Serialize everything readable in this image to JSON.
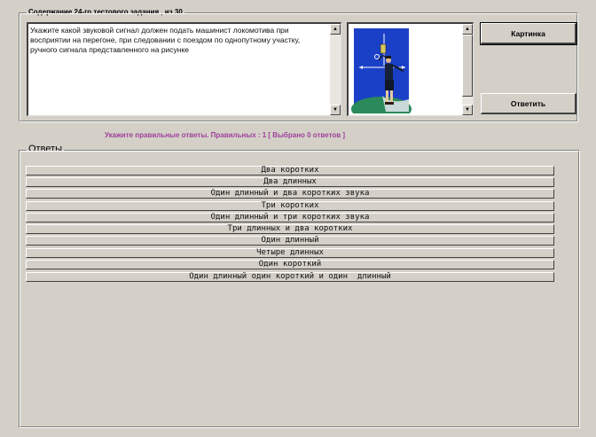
{
  "question": {
    "header": "Содержание 24-го тестового задания , из 30",
    "text": "Укажите какой звуковой сигнал должен подать машинист локомотива при восприятии на перегоне, при следовании с поездом по однопутному участку, ручного сигнала представленного на рисунке"
  },
  "buttons": {
    "picture": "Картинка",
    "answer": "Ответить"
  },
  "hint": "Укажите правильные ответы. Правильных : 1 [ Выбрано  0 ответов ]",
  "answers": {
    "title": "Ответы",
    "items": [
      "Два коротких",
      "Два длинных",
      "Один длинный и два коротких звука",
      "Три коротких",
      "Один длинный и три коротких звука",
      "Три длинных и два коротких",
      "Один длинный",
      "Четыре длинных",
      "Один короткий",
      "Один длинный один короткий и один  длинный"
    ]
  },
  "colors": {
    "background": "#d4d0c8",
    "hint": "#a0409a",
    "picture_sky": "#1b40c8",
    "picture_ground": "#2a8a5a"
  }
}
